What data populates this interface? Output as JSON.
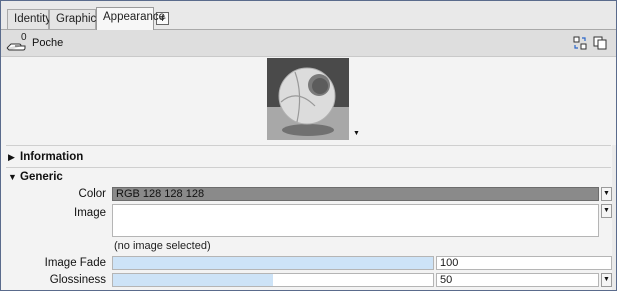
{
  "tabs": [
    {
      "label": "Identity"
    },
    {
      "label": "Graphics"
    },
    {
      "label": "Appearance"
    }
  ],
  "tab_add_label": "+",
  "toolbar": {
    "count": "0",
    "name": "Poche",
    "icons": [
      "hand-icon",
      "swap-icon",
      "copy-icon"
    ]
  },
  "sections": {
    "information": "Information",
    "generic": "Generic"
  },
  "fields": {
    "color_label": "Color",
    "color_value": "RGB 128 128 128",
    "image_label": "Image",
    "image_status": "(no image selected)",
    "image_fade_label": "Image Fade",
    "image_fade_value": "100",
    "image_fade_fraction": 1.0,
    "glossiness_label": "Glossiness",
    "glossiness_value": "50",
    "glossiness_fraction": 0.5
  },
  "dropdown_arrow": "▼",
  "colors": {
    "selection_blue": "#cde3f7",
    "color_swatch": "#808080",
    "frame_border": "#5a6b8c"
  }
}
